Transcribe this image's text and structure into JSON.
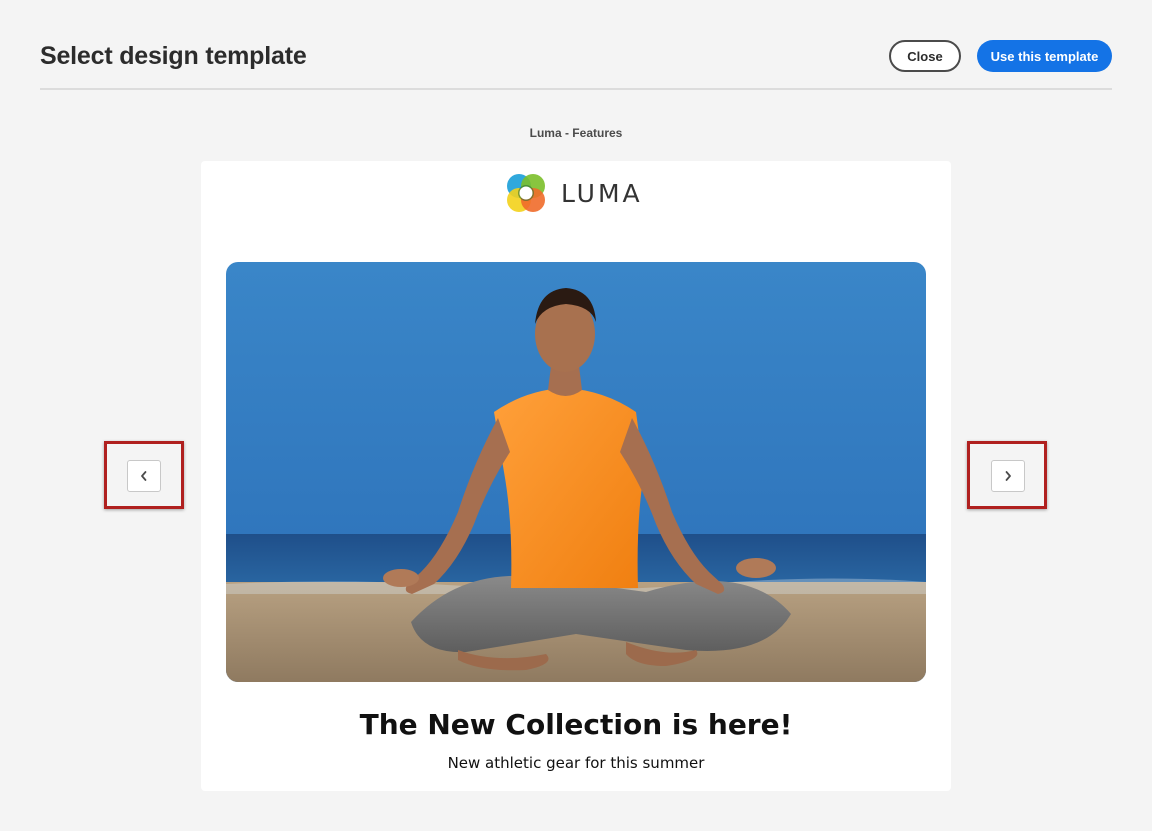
{
  "dialog": {
    "title": "Select design template",
    "close_label": "Close",
    "use_label": "Use this template"
  },
  "preview": {
    "template_name": "Luma - Features",
    "logo_text": "LUMA",
    "headline": "The New Collection is here!",
    "subline": "New athletic gear for this summer",
    "hero_image": "woman meditating on beach"
  },
  "navigation": {
    "prev_icon": "chevron-left-icon",
    "next_icon": "chevron-right-icon"
  },
  "colors": {
    "accent": "#1473e6",
    "highlight": "#b0201f",
    "background": "#f4f4f4"
  }
}
